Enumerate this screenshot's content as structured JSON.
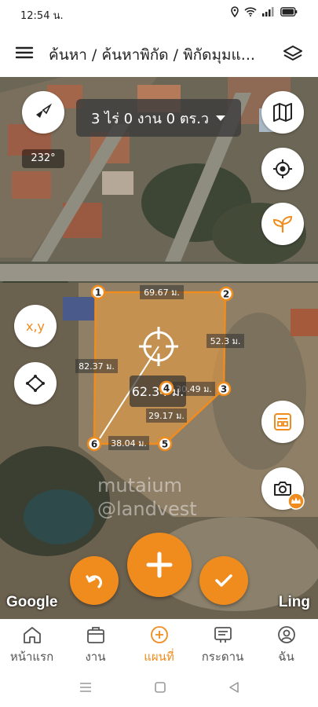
{
  "status_bar": {
    "time": "12:54 น."
  },
  "header": {
    "title": "ค้นหา / ค้นหาพิกัด / พิกัดมุมแ...",
    "menu_icon": "hamburger-icon",
    "layers_icon": "layers-icon"
  },
  "map": {
    "heading": "232°",
    "area_selector": "3 ไร่ 0 งาน 0 ตร.ว",
    "xy_label": "x,y",
    "points": [
      "1",
      "2",
      "3",
      "4",
      "5",
      "6"
    ],
    "edges": [
      "69.67 ม.",
      "52.3 ม.",
      "30.49 ม.",
      "29.17 ม.",
      "38.04 ม.",
      "82.37 ม."
    ],
    "radius_label": "62.34 ม.",
    "watermark_line1": "mutaium",
    "watermark_line2": "@landvest",
    "provider": "Google",
    "brand": "Ling",
    "colors": {
      "accent": "#f08c1d",
      "parcel_fill": "#f0a040"
    }
  },
  "bottom_nav": {
    "items": [
      {
        "label": "หน้าแรก",
        "icon": "home-icon"
      },
      {
        "label": "งาน",
        "icon": "briefcase-icon"
      },
      {
        "label": "แผนที่",
        "icon": "add-circle-icon"
      },
      {
        "label": "กระดาน",
        "icon": "board-icon"
      },
      {
        "label": "ฉัน",
        "icon": "user-icon"
      }
    ],
    "active": "แผนที่"
  }
}
